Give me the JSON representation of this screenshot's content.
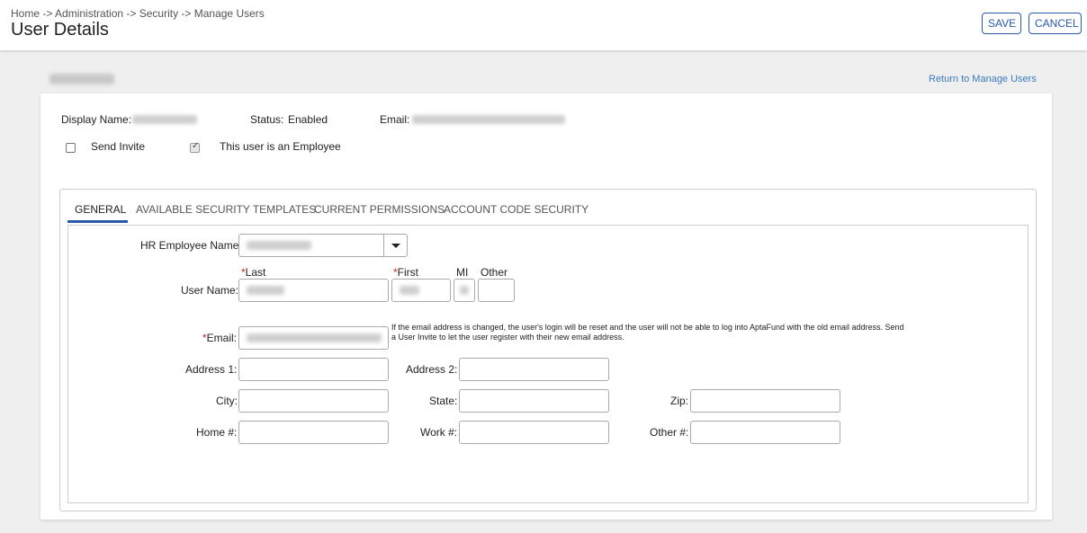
{
  "header": {
    "breadcrumb": "Home -> Administration -> Security -> Manage Users",
    "title": "User Details",
    "save_label": "SAVE",
    "cancel_label": "CANCEL"
  },
  "return_link": "Return to Manage Users",
  "summary": {
    "display_name_label": "Display Name:",
    "status_label": "Status:",
    "status_value": "Enabled",
    "email_label": "Email:",
    "send_invite_label": "Send Invite",
    "send_invite_checked": false,
    "employee_label": "This user is an Employee",
    "employee_checked": true
  },
  "tabs": [
    {
      "label": "GENERAL",
      "active": true
    },
    {
      "label": "AVAILABLE SECURITY TEMPLATES",
      "active": false
    },
    {
      "label": "CURRENT PERMISSIONS",
      "active": false
    },
    {
      "label": "ACCOUNT CODE SECURITY",
      "active": false
    }
  ],
  "form": {
    "hr_employee_label": "HR Employee Name:",
    "user_name_label": "User Name:",
    "last_label": "Last",
    "first_label": "First",
    "mi_label": "MI",
    "other_label": "Other",
    "required_mark": "*",
    "email_label": "Email:",
    "email_note": "If the email address is changed, the user's login will be reset and the user will not be able to log into AptaFund with the old email address. Send a User Invite to let the user register with their new email address.",
    "address1_label": "Address 1:",
    "address2_label": "Address 2:",
    "city_label": "City:",
    "state_label": "State:",
    "zip_label": "Zip:",
    "home_label": "Home #:",
    "work_label": "Work #:",
    "other_phone_label": "Other #:"
  }
}
